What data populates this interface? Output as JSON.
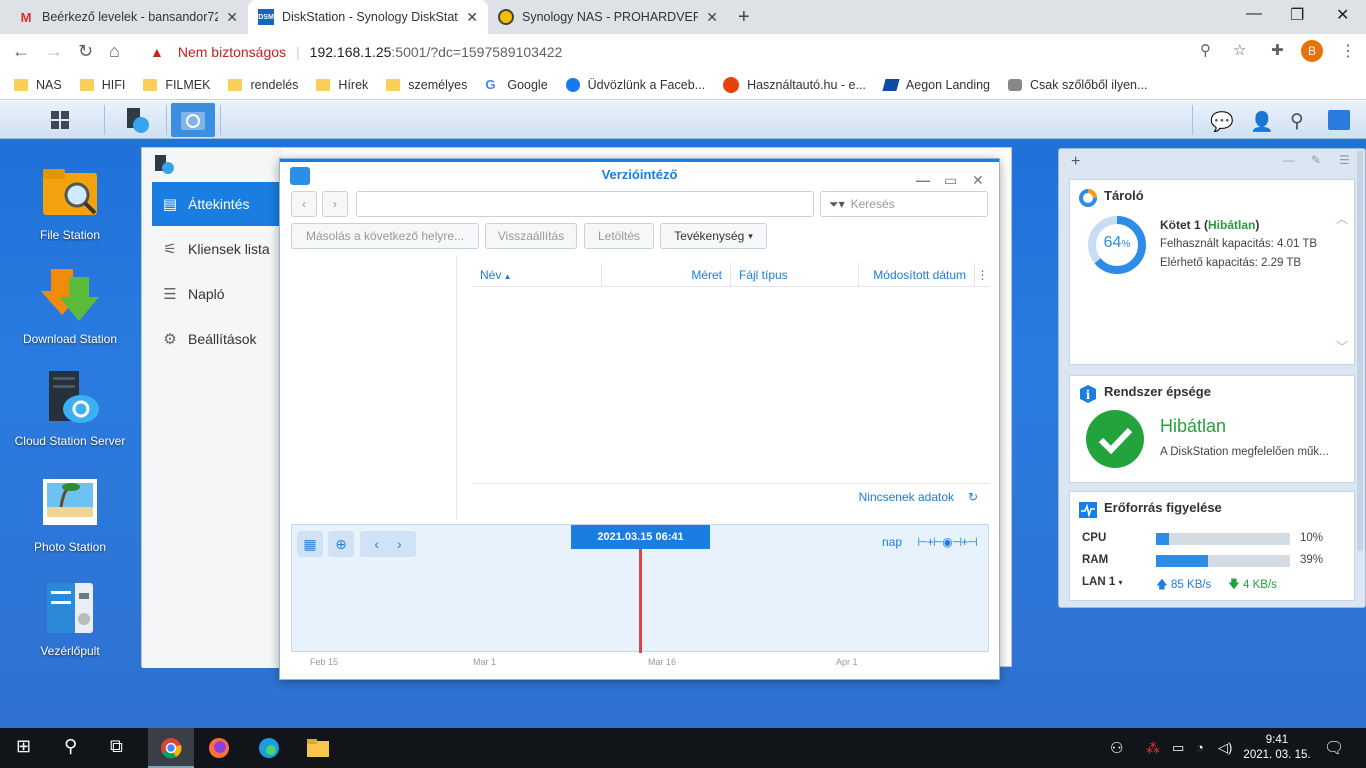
{
  "browser": {
    "tabs": [
      {
        "label": "Beérkező levelek - bansandor72(",
        "favicon": "gmail-icon"
      },
      {
        "label": "DiskStation - Synology DiskStatio",
        "favicon": "dsm-icon"
      },
      {
        "label": "Synology NAS - PROHARDVER! H",
        "favicon": "prohardver-icon"
      }
    ],
    "insecure_label": "Nem biztonságos",
    "url_host": "192.168.1.25",
    "url_rest": ":5001/?dc=1597589103422",
    "profile_initial": "B",
    "bookmarks": [
      "NAS",
      "HIFI",
      "FILMEK",
      "rendelés",
      "Hírek",
      "személyes",
      "Google",
      "Üdvözlünk a Faceb...",
      "Használtautó.hu - e...",
      "Aegon Landing",
      "Csak szőlőből ilyen..."
    ]
  },
  "desktop": {
    "icons": [
      {
        "label": "File Station"
      },
      {
        "label": "Download Station"
      },
      {
        "label": "Cloud Station Server"
      },
      {
        "label": "Photo Station"
      },
      {
        "label": "Vezérlőpult"
      }
    ]
  },
  "resource_window": {
    "menu": [
      "Áttekintés",
      "Kliensek lista",
      "Napló",
      "Beállítások"
    ]
  },
  "version_explorer": {
    "title": "Verzióintéző",
    "search_placeholder": "Keresés",
    "buttons": {
      "copy": "Másolás a következő helyre...",
      "restore": "Visszaállítás",
      "download": "Letöltés",
      "activity": "Tevékenység"
    },
    "columns": [
      "Név",
      "Méret",
      "Fájl típus",
      "Módosított dátum"
    ],
    "empty_text": "Nincsenek adatok",
    "timeline": {
      "current": "2021.03.15 06:41",
      "zoom_label": "nap",
      "months": [
        "Feb 15",
        "Mar 1",
        "Mar 16",
        "Apr 1"
      ]
    }
  },
  "widgets": {
    "storage": {
      "title": "Tároló",
      "percent": "64",
      "volume_name": "Kötet 1",
      "volume_status": "Hibátlan",
      "used_label": "Felhasznált kapacitás:",
      "used_value": "4.01 TB",
      "free_label": "Elérhető kapacitás:",
      "free_value": "2.29 TB"
    },
    "health": {
      "title": "Rendszer épsége",
      "status": "Hibátlan",
      "desc": "A DiskStation megfelelően műk..."
    },
    "resource": {
      "title": "Erőforrás figyelése",
      "cpu_label": "CPU",
      "cpu_value": "10%",
      "cpu_fraction": 0.1,
      "ram_label": "RAM",
      "ram_value": "39%",
      "ram_fraction": 0.39,
      "lan_label": "LAN 1",
      "up": "85 KB/s",
      "down": "4 KB/s"
    }
  },
  "taskbar": {
    "time": "9:41",
    "date": "2021. 03. 15."
  }
}
